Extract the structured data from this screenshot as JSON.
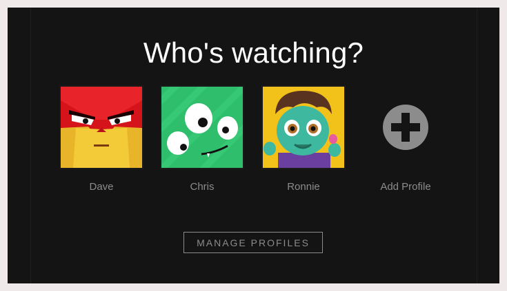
{
  "heading": "Who's watching?",
  "profiles": [
    {
      "name": "Dave"
    },
    {
      "name": "Chris"
    },
    {
      "name": "Ronnie"
    }
  ],
  "add_profile": {
    "label": "Add Profile"
  },
  "manage_button": {
    "label": "MANAGE PROFILES"
  },
  "colors": {
    "background": "#141414",
    "outer": "#efe9e9",
    "text_muted": "#8c8c8c",
    "title": "#ffffff",
    "dave_red": "#d4131a",
    "dave_yellow": "#f0c12e",
    "chris_green": "#2fbe6b",
    "ronnie_yellow": "#f2c21b",
    "add_grey": "#8c8c8c"
  }
}
